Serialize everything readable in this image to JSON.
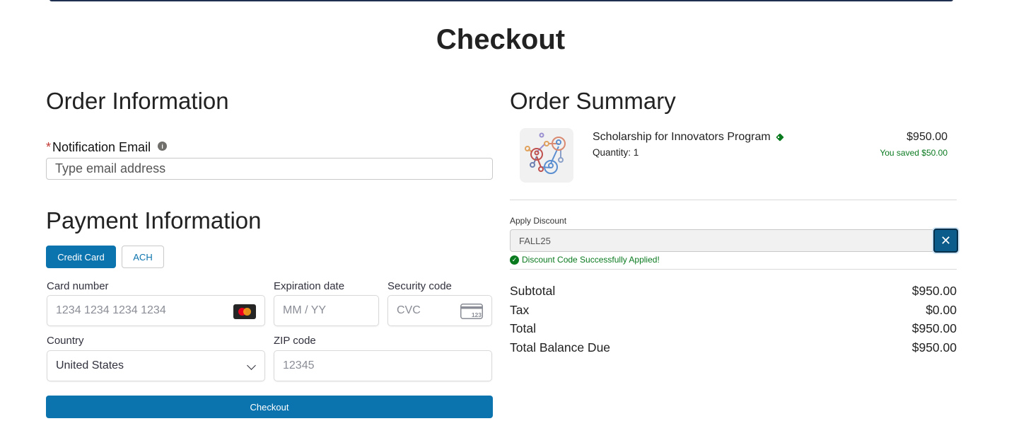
{
  "page": {
    "title": "Checkout"
  },
  "order_info": {
    "heading": "Order Information",
    "email_required_mark": "*",
    "email_label": "Notification Email",
    "email_info_icon": "info-icon",
    "email_placeholder": "Type email address"
  },
  "payment": {
    "heading": "Payment Information",
    "tabs": [
      {
        "label": "Credit Card",
        "active": true
      },
      {
        "label": "ACH",
        "active": false
      }
    ],
    "card_number_label": "Card number",
    "card_number_placeholder": "1234 1234 1234 1234",
    "card_brand_icon": "mastercard-icon",
    "expiration_label": "Expiration date",
    "expiration_placeholder": "MM / YY",
    "security_label": "Security code",
    "security_placeholder": "CVC",
    "cvc_icon": "cvc-card-icon",
    "cvc_icon_text": "123",
    "country_label": "Country",
    "country_value": "United States",
    "zip_label": "ZIP code",
    "zip_placeholder": "12345",
    "checkout_button": "Checkout"
  },
  "summary": {
    "heading": "Order Summary",
    "product": {
      "name": "Scholarship for Innovators Program",
      "quantity": "Quantity: 1",
      "price": "$950.00",
      "saved": "You saved $50.00",
      "tag_icon": "discount-tag-icon"
    },
    "discount": {
      "label": "Apply Discount",
      "value": "FALL25",
      "clear_glyph": "✕",
      "success_message": "Discount Code Successfully Applied!"
    },
    "totals": [
      {
        "label": "Subtotal",
        "value": "$950.00"
      },
      {
        "label": "Tax",
        "value": "$0.00"
      },
      {
        "label": "Total",
        "value": "$950.00"
      },
      {
        "label": "Total Balance Due",
        "value": "$950.00"
      }
    ]
  },
  "colors": {
    "primary": "#0b73ad",
    "success": "#0a7a1f",
    "required": "#c23934"
  }
}
